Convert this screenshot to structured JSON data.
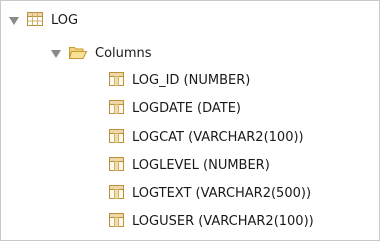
{
  "tree": {
    "table": {
      "label": "LOG",
      "icon": "table-icon",
      "expanded": true
    },
    "columns_folder": {
      "label": "Columns",
      "icon": "folder-open-icon",
      "expanded": true
    },
    "columns": [
      {
        "label": "LOG_ID (NUMBER)",
        "icon": "column-icon"
      },
      {
        "label": "LOGDATE (DATE)",
        "icon": "column-icon"
      },
      {
        "label": "LOGCAT (VARCHAR2(100))",
        "icon": "column-icon"
      },
      {
        "label": "LOGLEVEL (NUMBER)",
        "icon": "column-icon"
      },
      {
        "label": "LOGTEXT (VARCHAR2(500))",
        "icon": "column-icon"
      },
      {
        "label": "LOGUSER (VARCHAR2(100))",
        "icon": "column-icon"
      }
    ]
  }
}
